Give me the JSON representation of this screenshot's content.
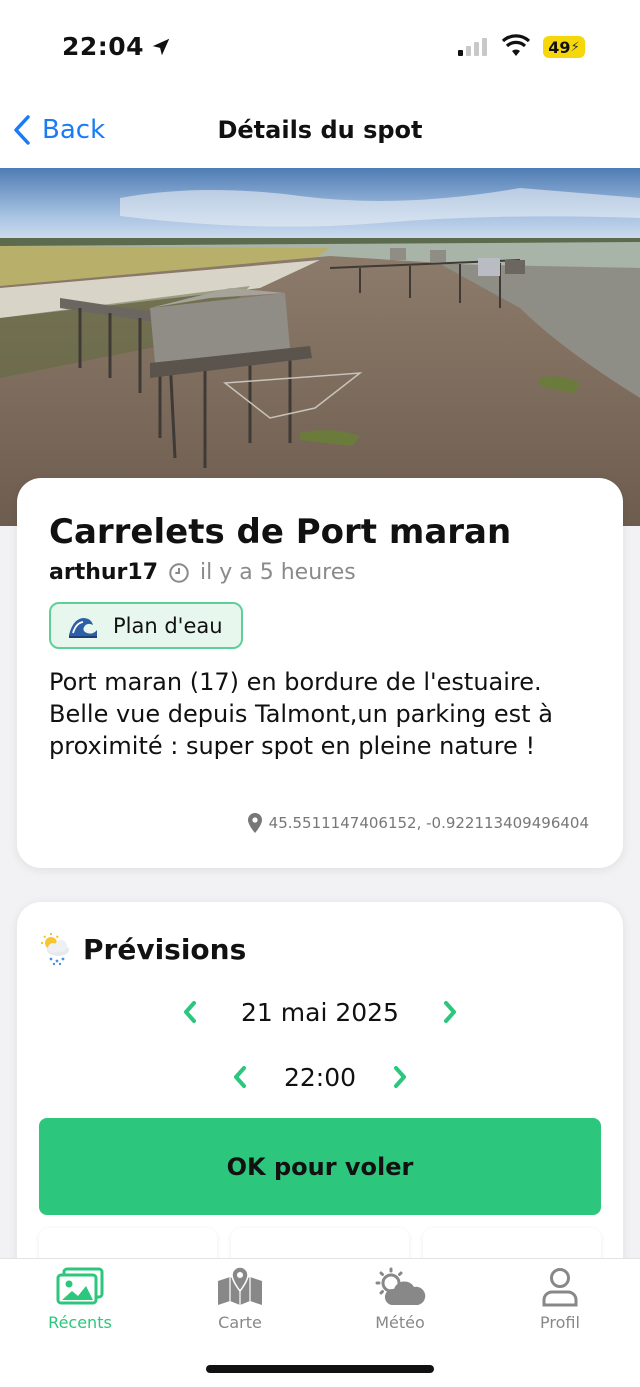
{
  "status_bar": {
    "time": "22:04",
    "battery": "49"
  },
  "nav": {
    "back_label": "Back",
    "title": "Détails du spot"
  },
  "spot": {
    "title": "Carrelets de Port maran",
    "author": "arthur17",
    "posted": "il y a 5 heures",
    "tag": "Plan d'eau",
    "description": "Port maran (17) en bordure de l'estuaire. Belle vue depuis Talmont,un parking est à proximité : super spot en pleine nature !",
    "coordinates": "45.5511147406152, -0.922113409496404"
  },
  "forecast": {
    "title": "Prévisions",
    "date": "21 mai 2025",
    "hour": "22:00",
    "verdict": "OK pour voler"
  },
  "tabs": [
    {
      "label": "Récents",
      "icon": "photos-icon",
      "active": true
    },
    {
      "label": "Carte",
      "icon": "map-icon",
      "active": false
    },
    {
      "label": "Météo",
      "icon": "weather-icon",
      "active": false
    },
    {
      "label": "Profil",
      "icon": "profile-icon",
      "active": false
    }
  ],
  "colors": {
    "accent": "#2cc67c",
    "link": "#1a7cf5",
    "tag_bg": "#e7f7ee"
  }
}
